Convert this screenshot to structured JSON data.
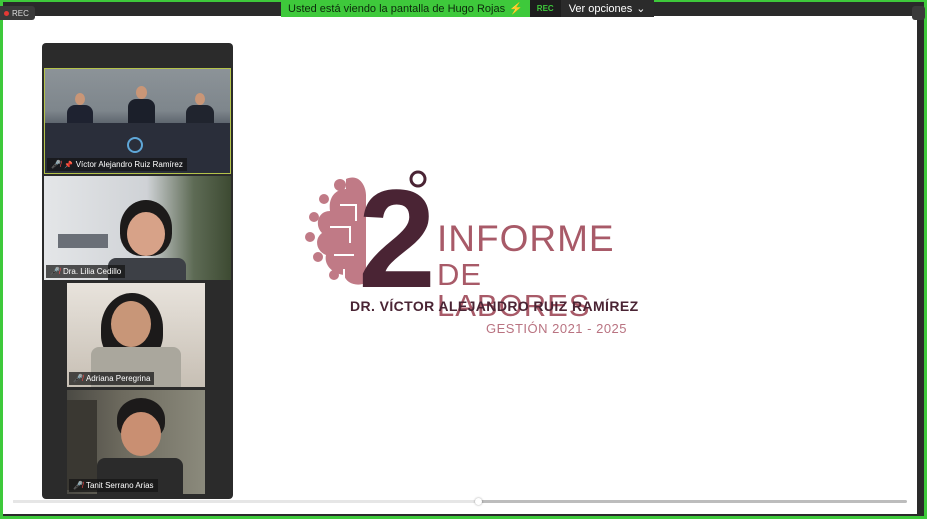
{
  "banner": {
    "viewing_text": "Usted está viendo la pantalla de Hugo Rojas",
    "rec_label": "REC",
    "options_label": "Ver opciones"
  },
  "rec_chip": {
    "label": "REC"
  },
  "participants": [
    {
      "name": "Víctor Alejandro Ruiz Ramírez",
      "muted": true,
      "pinned": true
    },
    {
      "name": "Dra. Lilia Cedillo",
      "muted": true
    },
    {
      "name": "Adriana Peregrina",
      "muted": true
    },
    {
      "name": "Tanit Serrano Arias",
      "muted": true
    }
  ],
  "shared_slide": {
    "logo_number": "2",
    "title_line1": "INFORME",
    "title_line2": "DE LABORES",
    "person": "DR. VÍCTOR ALEJANDRO RUIZ RAMÍREZ",
    "period": "GESTIÓN 2021 - 2025"
  },
  "colors": {
    "share_border": "#3ec93b",
    "brand_rose": "#a85a68",
    "brand_dark": "#4a2434"
  },
  "video_progress": {
    "fraction": 0.52
  }
}
